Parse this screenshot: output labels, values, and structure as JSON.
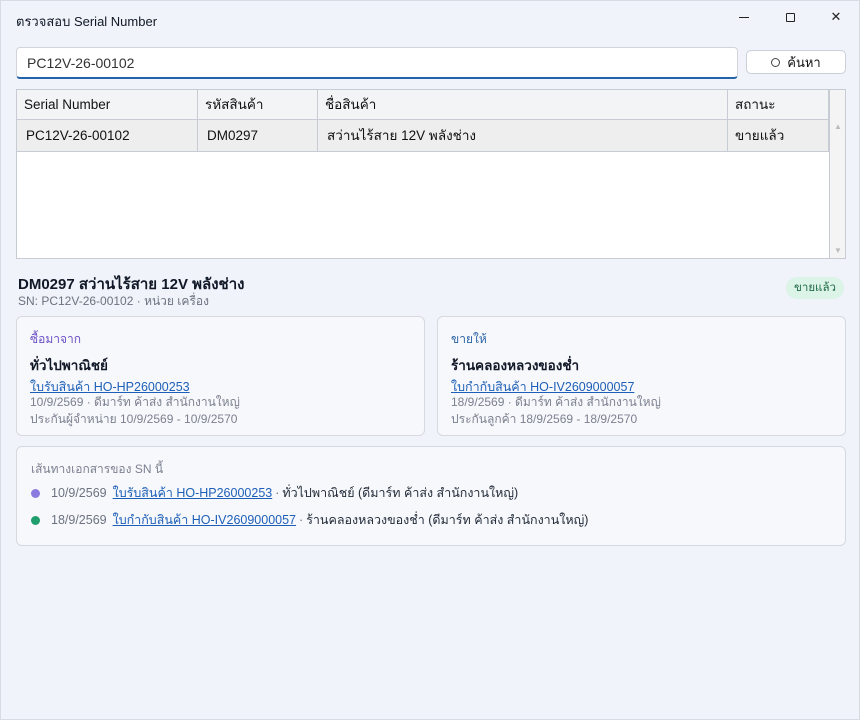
{
  "window": {
    "title": "ตรวจสอบ Serial Number"
  },
  "search": {
    "value": "PC12V-26-00102",
    "button_label": "ค้นหา"
  },
  "grid": {
    "columns": [
      "Serial Number",
      "รหัสสินค้า",
      "ชื่อสินค้า",
      "สถานะ"
    ],
    "rows": [
      [
        "PC12V-26-00102",
        "DM0297",
        "สว่านไร้สาย 12V พลังช่าง",
        "ขายแล้ว"
      ]
    ]
  },
  "detail": {
    "title": "DM0297 สว่านไร้สาย 12V พลังช่าง",
    "sub": "SN: PC12V-26-00102 · หน่วย เครื่อง",
    "status": "ขายแล้ว",
    "status_color": "#dcf3e7"
  },
  "purchase": {
    "label": "ซื้อมาจาก",
    "name": "ทั่วไปพาณิชย์",
    "doc_link": "ใบรับสินค้า HO-HP26000253",
    "meta": "10/9/2569 · ดีมาร์ท ค้าส่ง สำนักงานใหญ่",
    "warranty": "ประกันผู้จำหน่าย 10/9/2569 - 10/9/2570"
  },
  "sale": {
    "label": "ขายให้",
    "name": "ร้านคลองหลวงของช่ำ",
    "doc_link": "ใบกำกับสินค้า HO-IV2609000057",
    "meta": "18/9/2569 · ดีมาร์ท ค้าส่ง สำนักงานใหญ่",
    "warranty": "ประกันลูกค้า 18/9/2569 - 18/9/2570"
  },
  "trail": {
    "heading": "เส้นทางเอกสารของ SN นี้",
    "items": [
      {
        "date": "10/9/2569",
        "link": "ใบรับสินค้า HO-HP26000253",
        "rest": "ทั่วไปพาณิชย์ (ดีมาร์ท ค้าส่ง สำนักงานใหญ่)",
        "dot_color": "#8b7be0"
      },
      {
        "date": "18/9/2569",
        "link": "ใบกำกับสินค้า HO-IV2609000057",
        "rest": "ร้านคลองหลวงของช่ำ (ดีมาร์ท ค้าส่ง สำนักงานใหญ่)",
        "dot_color": "#1f9e6e"
      }
    ]
  }
}
